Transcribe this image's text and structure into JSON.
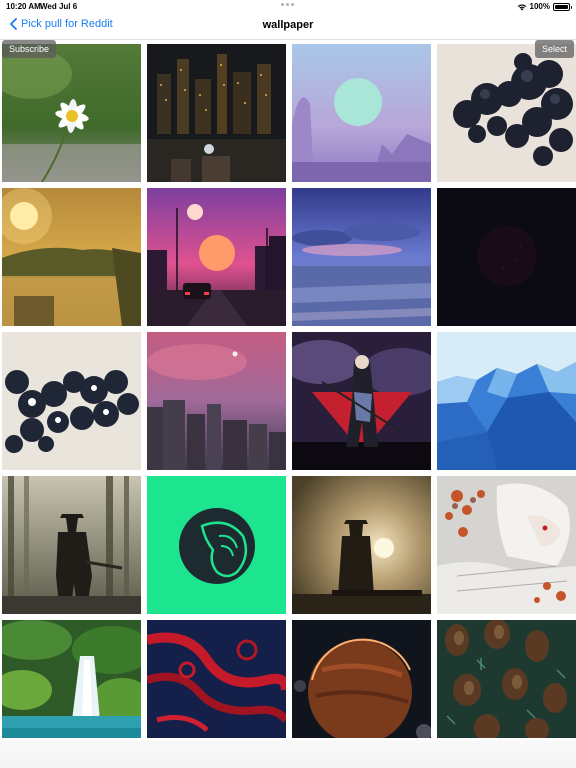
{
  "status_bar": {
    "time": "10:20 AM",
    "date": "Wed Jul 6",
    "battery_percent": "100%",
    "battery_level": 1.0
  },
  "nav": {
    "back_label": "Pick pull for Reddit",
    "title": "wallpaper"
  },
  "actions": {
    "subscribe_label": "Subscribe",
    "select_label": "Select"
  },
  "colors": {
    "accent": "#1a7cf5"
  },
  "tiles": [
    "daisy-flower",
    "night-city-balcony",
    "pastel-moon-desert",
    "black-bubbles",
    "golden-sunrise-lake",
    "synthwave-road",
    "purple-sea-clouds",
    "dark-particles",
    "dark-bubbles-beige",
    "pink-sky-buildings",
    "anime-warrior-red",
    "blue-lowpoly",
    "cowboy-forest",
    "alien-logo-green",
    "cowboy-sunset-fog",
    "anime-girl-flowers",
    "waterfall-moss",
    "red-swirl-navy",
    "orange-planet",
    "pine-cones"
  ]
}
